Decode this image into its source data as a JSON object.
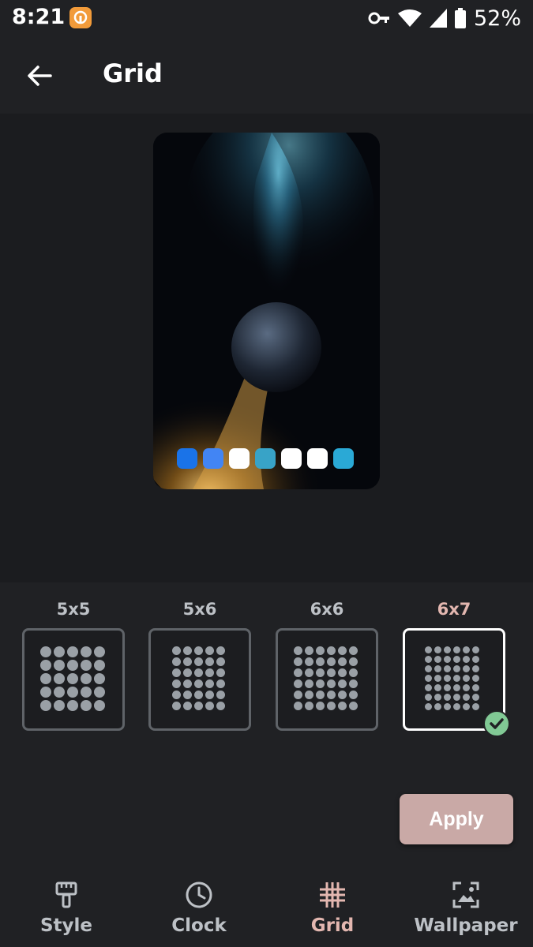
{
  "status_bar": {
    "time": "8:21",
    "battery": "52%"
  },
  "header": {
    "title": "Grid"
  },
  "grid_options": [
    {
      "label": "5x5",
      "cols": 5,
      "rows": 5,
      "selected": false
    },
    {
      "label": "5x6",
      "cols": 5,
      "rows": 6,
      "selected": false
    },
    {
      "label": "6x6",
      "cols": 6,
      "rows": 6,
      "selected": false
    },
    {
      "label": "6x7",
      "cols": 6,
      "rows": 7,
      "selected": true
    }
  ],
  "apply_label": "Apply",
  "nav": [
    {
      "label": "Style",
      "icon": "brush-icon",
      "active": false
    },
    {
      "label": "Clock",
      "icon": "clock-icon",
      "active": false
    },
    {
      "label": "Grid",
      "icon": "grid-icon",
      "active": true
    },
    {
      "label": "Wallpaper",
      "icon": "wallpaper-icon",
      "active": false
    }
  ],
  "dock_apps": [
    "phone-icon",
    "messages-icon",
    "play-movies-icon",
    "kiwi-browser-icon",
    "photos-icon",
    "play-store-icon",
    "cx-file-explorer-icon"
  ],
  "colors": {
    "accent": "#e3b7b0",
    "apply_bg": "#c9a9a6",
    "check": "#81c995"
  }
}
